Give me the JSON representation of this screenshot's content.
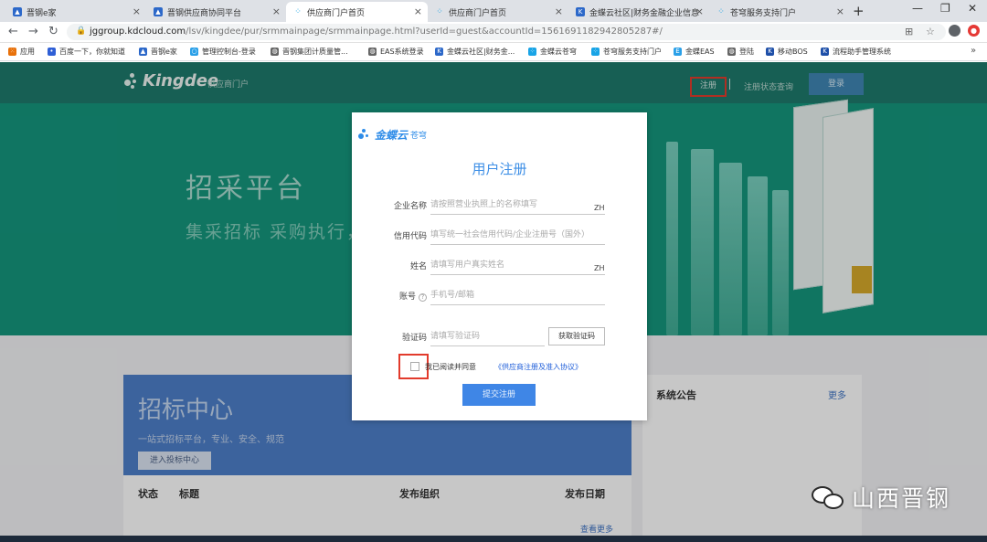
{
  "browser": {
    "tabs": [
      {
        "title": "晋钢e家"
      },
      {
        "title": "晋钢供应商协同平台"
      },
      {
        "title": "供应商门户首页"
      },
      {
        "title": "供应商门户首页"
      },
      {
        "title": "金蝶云社区|财务金融企业信息"
      },
      {
        "title": "苍穹服务支持门户"
      }
    ],
    "url_host": "jggroup.kdcloud.com",
    "url_path": "/lsv/kingdee/pur/srmmainpage/srmmainpage.html?userId=guest&accountId=1561691182942805287#/"
  },
  "bookmarks": [
    "应用",
    "百度一下，你就知道",
    "晋钢e家",
    "管理控制台-登录",
    "晋钢集团计质量管...",
    "EAS系统登录",
    "金蝶云社区|财务金...",
    "金蝶云苍穹",
    "苍穹服务支持门户",
    "金蝶EAS",
    "登陆",
    "移动BOS",
    "流程助手管理系统"
  ],
  "header": {
    "logo": "Kingdee",
    "logo_sub": "供应商门户",
    "register": "注册",
    "status_query": "注册状态查询",
    "login": "登录"
  },
  "banner": {
    "title": "招采平台",
    "subtitle": "集采招标 采购执行，一"
  },
  "tender": {
    "title": "招标中心",
    "desc": "一站式招标平台，专业、安全、规范",
    "enter": "进入投标中心",
    "col_status": "状态",
    "col_title": "标题",
    "col_org": "发布组织",
    "col_date": "发布日期",
    "more": "查看更多"
  },
  "notice": {
    "title": "系统公告",
    "more": "更多"
  },
  "modal": {
    "logo": "金蝶云",
    "logo_sub": "苍穹",
    "title": "用户注册",
    "fields": [
      {
        "label": "企业名称",
        "placeholder": "请按照营业执照上的名称填写",
        "suffix": "ZH"
      },
      {
        "label": "信用代码",
        "placeholder": "填写统一社会信用代码/企业注册号（国外）",
        "suffix": ""
      },
      {
        "label": "姓名",
        "placeholder": "请填写用户真实姓名",
        "suffix": "ZH"
      },
      {
        "label": "账号",
        "placeholder": "手机号/邮箱",
        "suffix": ""
      }
    ],
    "sms": {
      "label": "验证码",
      "placeholder": "请填写验证码",
      "button": "获取验证码"
    },
    "agree": "我已阅读并同意",
    "agreement_link": "《供应商注册及准入协议》",
    "submit": "提交注册"
  },
  "watermark": "山西晋钢",
  "colors": {
    "header_bg": "#1e7a6c",
    "banner_bg": "#15967d",
    "accent_blue": "#3f86e6",
    "highlight_red": "#e23b2c"
  }
}
